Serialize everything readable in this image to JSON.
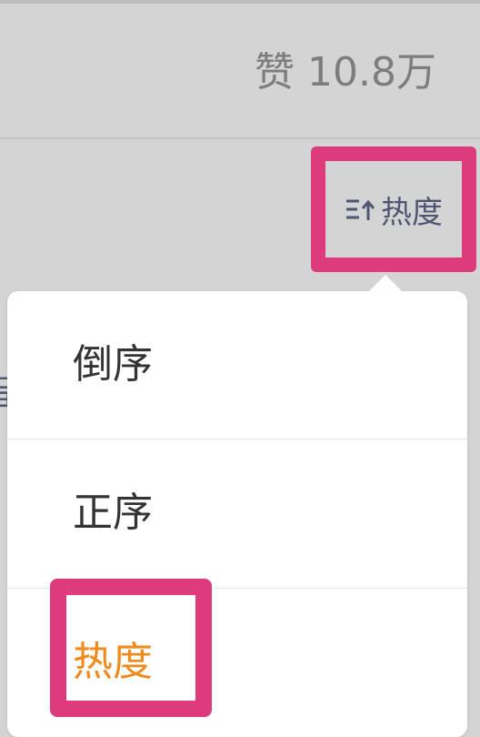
{
  "likes": {
    "text": "赞 10.8万"
  },
  "sort_toggle": {
    "label": "热度",
    "icon": "sort-ascending-icon"
  },
  "sort_menu": {
    "items": [
      {
        "label": "倒序"
      },
      {
        "label": "正序"
      },
      {
        "label": "热度"
      }
    ],
    "selected_index": 2
  },
  "colors": {
    "highlight": "#dd3b7c",
    "selected": "#f08a1c",
    "toggle_text": "#4f5673"
  }
}
